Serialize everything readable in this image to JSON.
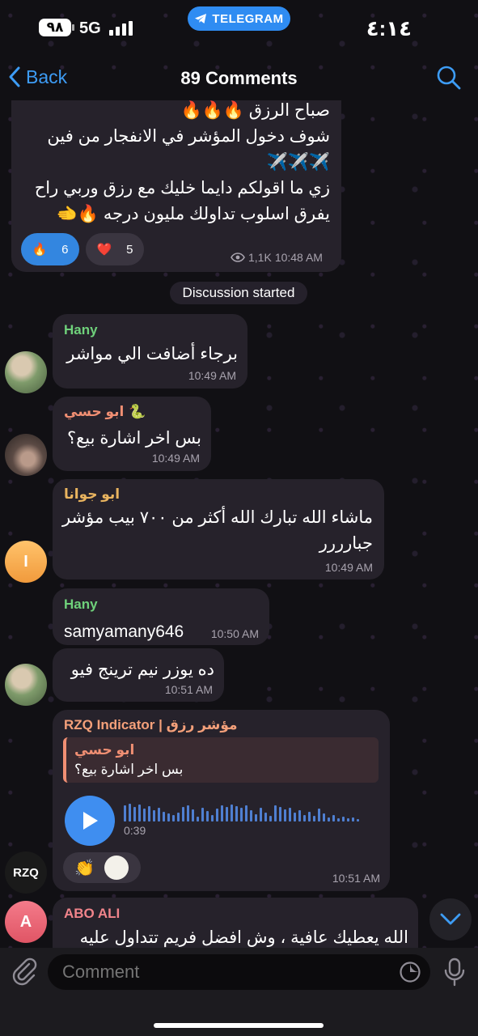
{
  "status_bar": {
    "battery": "٩٨",
    "network": "5G",
    "app_pill": "TELEGRAM",
    "time": "٤:١٤"
  },
  "header": {
    "back_label": "Back",
    "title": "89 Comments"
  },
  "post": {
    "lines": [
      "صباح الرزق 🔥🔥🔥",
      "شوف دخول المؤشر في الانفجار من فين",
      "✈️✈️✈️",
      "زي ما اقولكم دايما خليك مع رزق وربي راح",
      "يفرق اسلوب تداولك مليون درجه 🔥🫲"
    ],
    "reactions": [
      {
        "emoji": "🔥",
        "count": "6"
      },
      {
        "emoji": "❤️",
        "count": "5"
      }
    ],
    "views": "1,1K",
    "time": "10:48 AM"
  },
  "system_message": "Discussion started",
  "messages": [
    {
      "sender": "Hany",
      "text": "برجاء أضافت الي مواشر",
      "time": "10:49 AM"
    },
    {
      "sender": "ابو حسي",
      "sender_emoji": "🐍",
      "text": "بس اخر اشارة بيع؟",
      "time": "10:49 AM"
    },
    {
      "sender": "ابو جوانا",
      "avatar_initial": "I",
      "text_line1": "ماشاء الله تبارك الله أكثر من ٧٠٠ بيب مؤشر",
      "text_line2": "جبارررر",
      "time": "10:49 AM"
    },
    {
      "sender": "Hany",
      "text": "samyamany646",
      "time": "10:50 AM"
    },
    {
      "text": "ده يوزر نيم ترينج فيو",
      "time": "10:51 AM"
    },
    {
      "sender": "RZQ Indicator | مؤشر رزق",
      "reply_sender": "ابو حسي",
      "reply_text": "بس اخر اشارة بيع؟",
      "voice_duration": "0:39",
      "reaction_emoji": "👏",
      "avatar_text": "RZQ",
      "time": "10:51 AM"
    },
    {
      "sender": "ABO ALI",
      "avatar_initial": "A",
      "text": "الله يعطيك عافية ، وش افضل فريم تتداول عليه"
    }
  ],
  "input": {
    "placeholder": "Comment"
  },
  "colors": {
    "accent": "#3d9cf5",
    "hany": "#6fd17b",
    "abu_hasi": "#f08f73",
    "abu_juana": "#e9b45f",
    "rzq": "#f4a07a",
    "abo_ali": "#f1848b",
    "bubble": "#26222b"
  }
}
